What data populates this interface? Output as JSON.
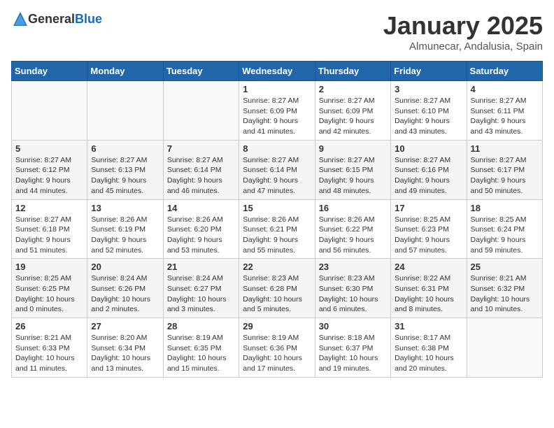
{
  "logo": {
    "text_general": "General",
    "text_blue": "Blue"
  },
  "title": "January 2025",
  "subtitle": "Almunecar, Andalusia, Spain",
  "days_of_week": [
    "Sunday",
    "Monday",
    "Tuesday",
    "Wednesday",
    "Thursday",
    "Friday",
    "Saturday"
  ],
  "weeks": [
    [
      {
        "day": "",
        "info": ""
      },
      {
        "day": "",
        "info": ""
      },
      {
        "day": "",
        "info": ""
      },
      {
        "day": "1",
        "info": "Sunrise: 8:27 AM\nSunset: 6:09 PM\nDaylight: 9 hours\nand 41 minutes."
      },
      {
        "day": "2",
        "info": "Sunrise: 8:27 AM\nSunset: 6:09 PM\nDaylight: 9 hours\nand 42 minutes."
      },
      {
        "day": "3",
        "info": "Sunrise: 8:27 AM\nSunset: 6:10 PM\nDaylight: 9 hours\nand 43 minutes."
      },
      {
        "day": "4",
        "info": "Sunrise: 8:27 AM\nSunset: 6:11 PM\nDaylight: 9 hours\nand 43 minutes."
      }
    ],
    [
      {
        "day": "5",
        "info": "Sunrise: 8:27 AM\nSunset: 6:12 PM\nDaylight: 9 hours\nand 44 minutes."
      },
      {
        "day": "6",
        "info": "Sunrise: 8:27 AM\nSunset: 6:13 PM\nDaylight: 9 hours\nand 45 minutes."
      },
      {
        "day": "7",
        "info": "Sunrise: 8:27 AM\nSunset: 6:14 PM\nDaylight: 9 hours\nand 46 minutes."
      },
      {
        "day": "8",
        "info": "Sunrise: 8:27 AM\nSunset: 6:14 PM\nDaylight: 9 hours\nand 47 minutes."
      },
      {
        "day": "9",
        "info": "Sunrise: 8:27 AM\nSunset: 6:15 PM\nDaylight: 9 hours\nand 48 minutes."
      },
      {
        "day": "10",
        "info": "Sunrise: 8:27 AM\nSunset: 6:16 PM\nDaylight: 9 hours\nand 49 minutes."
      },
      {
        "day": "11",
        "info": "Sunrise: 8:27 AM\nSunset: 6:17 PM\nDaylight: 9 hours\nand 50 minutes."
      }
    ],
    [
      {
        "day": "12",
        "info": "Sunrise: 8:27 AM\nSunset: 6:18 PM\nDaylight: 9 hours\nand 51 minutes."
      },
      {
        "day": "13",
        "info": "Sunrise: 8:26 AM\nSunset: 6:19 PM\nDaylight: 9 hours\nand 52 minutes."
      },
      {
        "day": "14",
        "info": "Sunrise: 8:26 AM\nSunset: 6:20 PM\nDaylight: 9 hours\nand 53 minutes."
      },
      {
        "day": "15",
        "info": "Sunrise: 8:26 AM\nSunset: 6:21 PM\nDaylight: 9 hours\nand 55 minutes."
      },
      {
        "day": "16",
        "info": "Sunrise: 8:26 AM\nSunset: 6:22 PM\nDaylight: 9 hours\nand 56 minutes."
      },
      {
        "day": "17",
        "info": "Sunrise: 8:25 AM\nSunset: 6:23 PM\nDaylight: 9 hours\nand 57 minutes."
      },
      {
        "day": "18",
        "info": "Sunrise: 8:25 AM\nSunset: 6:24 PM\nDaylight: 9 hours\nand 59 minutes."
      }
    ],
    [
      {
        "day": "19",
        "info": "Sunrise: 8:25 AM\nSunset: 6:25 PM\nDaylight: 10 hours\nand 0 minutes."
      },
      {
        "day": "20",
        "info": "Sunrise: 8:24 AM\nSunset: 6:26 PM\nDaylight: 10 hours\nand 2 minutes."
      },
      {
        "day": "21",
        "info": "Sunrise: 8:24 AM\nSunset: 6:27 PM\nDaylight: 10 hours\nand 3 minutes."
      },
      {
        "day": "22",
        "info": "Sunrise: 8:23 AM\nSunset: 6:28 PM\nDaylight: 10 hours\nand 5 minutes."
      },
      {
        "day": "23",
        "info": "Sunrise: 8:23 AM\nSunset: 6:30 PM\nDaylight: 10 hours\nand 6 minutes."
      },
      {
        "day": "24",
        "info": "Sunrise: 8:22 AM\nSunset: 6:31 PM\nDaylight: 10 hours\nand 8 minutes."
      },
      {
        "day": "25",
        "info": "Sunrise: 8:21 AM\nSunset: 6:32 PM\nDaylight: 10 hours\nand 10 minutes."
      }
    ],
    [
      {
        "day": "26",
        "info": "Sunrise: 8:21 AM\nSunset: 6:33 PM\nDaylight: 10 hours\nand 11 minutes."
      },
      {
        "day": "27",
        "info": "Sunrise: 8:20 AM\nSunset: 6:34 PM\nDaylight: 10 hours\nand 13 minutes."
      },
      {
        "day": "28",
        "info": "Sunrise: 8:19 AM\nSunset: 6:35 PM\nDaylight: 10 hours\nand 15 minutes."
      },
      {
        "day": "29",
        "info": "Sunrise: 8:19 AM\nSunset: 6:36 PM\nDaylight: 10 hours\nand 17 minutes."
      },
      {
        "day": "30",
        "info": "Sunrise: 8:18 AM\nSunset: 6:37 PM\nDaylight: 10 hours\nand 19 minutes."
      },
      {
        "day": "31",
        "info": "Sunrise: 8:17 AM\nSunset: 6:38 PM\nDaylight: 10 hours\nand 20 minutes."
      },
      {
        "day": "",
        "info": ""
      }
    ]
  ]
}
